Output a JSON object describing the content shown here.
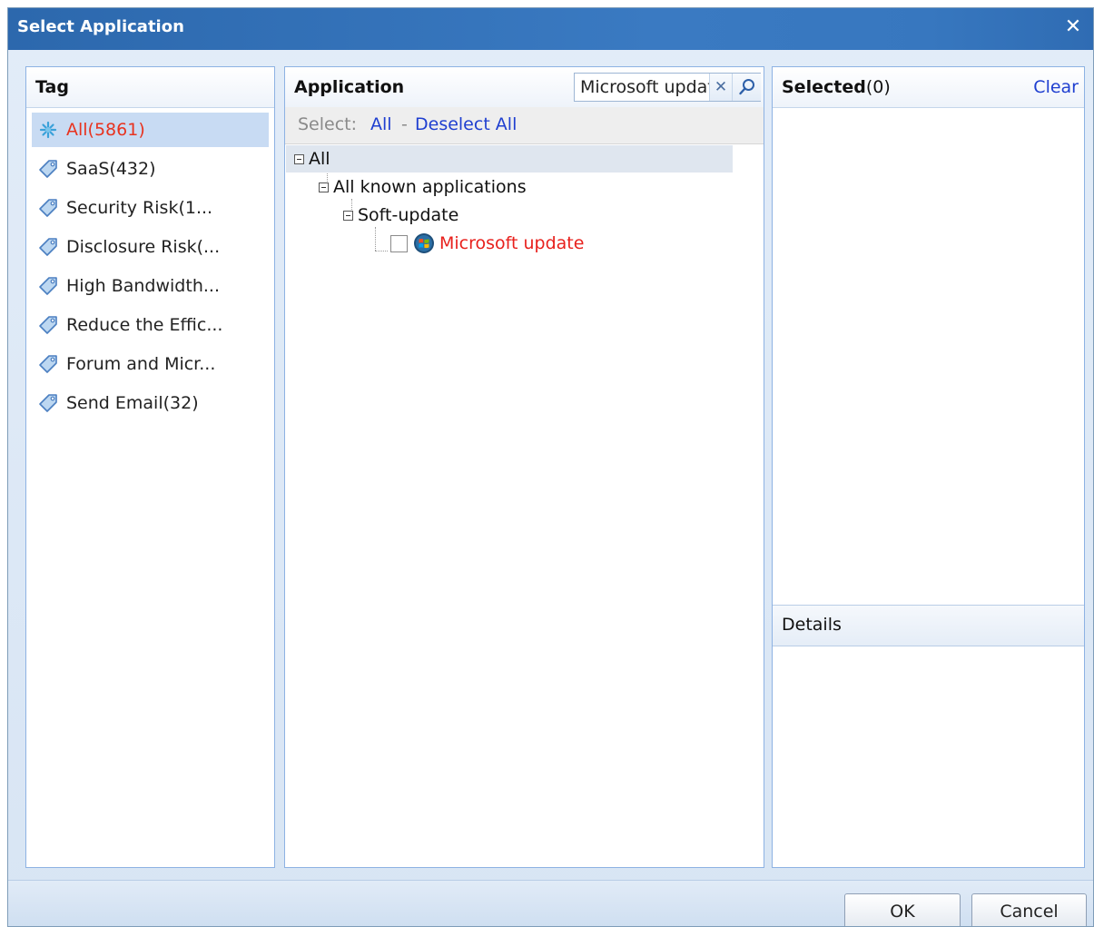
{
  "dialog": {
    "title": "Select Application",
    "close_glyph": "✕"
  },
  "tag_panel": {
    "header": "Tag",
    "items": [
      {
        "label": "All(5861)",
        "icon": "asterisk-icon",
        "active": true
      },
      {
        "label": "SaaS(432)",
        "icon": "tag-icon"
      },
      {
        "label": "Security Risk(1...",
        "icon": "tag-icon"
      },
      {
        "label": "Disclosure Risk(...",
        "icon": "tag-icon"
      },
      {
        "label": "High Bandwidth...",
        "icon": "tag-icon"
      },
      {
        "label": "Reduce the Effic...",
        "icon": "tag-icon"
      },
      {
        "label": "Forum and Micr...",
        "icon": "tag-icon"
      },
      {
        "label": "Send Email(32)",
        "icon": "tag-icon"
      }
    ]
  },
  "app_panel": {
    "header": "Application",
    "search_value": "Microsoft update",
    "clear_glyph": "✕",
    "select_label": "Select:",
    "select_all": "All",
    "separator": "-",
    "deselect_all": "Deselect All",
    "tree": {
      "root": "All",
      "level1": "All known applications",
      "level2": "Soft-update",
      "leaf": "Microsoft update"
    }
  },
  "selected_panel": {
    "header": "Selected",
    "count": "(0)",
    "clear": "Clear",
    "details_header": "Details"
  },
  "footer": {
    "ok": "OK",
    "cancel": "Cancel"
  },
  "colors": {
    "title_bar": "#2c68ad",
    "active_tag_text": "#e8331f",
    "link": "#1f3fd0",
    "leaf_text": "#e8201c"
  }
}
